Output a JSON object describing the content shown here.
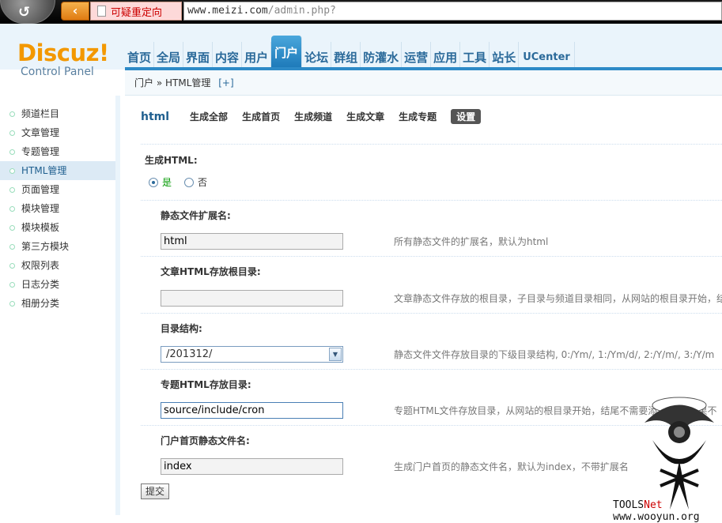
{
  "browser": {
    "warning_text": "可疑重定向",
    "url_base": "www.meizi.com",
    "url_path": "/admin.php?"
  },
  "header": {
    "logo": "Discuz!",
    "logo_sub": "Control Panel",
    "nav": [
      {
        "label": "首页"
      },
      {
        "label": "全局"
      },
      {
        "label": "界面"
      },
      {
        "label": "内容"
      },
      {
        "label": "用户"
      },
      {
        "label": "门户",
        "active": true
      },
      {
        "label": "论坛"
      },
      {
        "label": "群组"
      },
      {
        "label": "防灌水"
      },
      {
        "label": "运营"
      },
      {
        "label": "应用"
      },
      {
        "label": "工具"
      },
      {
        "label": "站长"
      },
      {
        "label": "UCenter"
      }
    ],
    "breadcrumb": {
      "root": "门户",
      "sep": "»",
      "current": "HTML管理",
      "plus": "[+]"
    }
  },
  "sidebar": {
    "items": [
      {
        "label": "频道栏目"
      },
      {
        "label": "文章管理"
      },
      {
        "label": "专题管理"
      },
      {
        "label": "HTML管理",
        "active": true
      },
      {
        "label": "页面管理"
      },
      {
        "label": "模块管理"
      },
      {
        "label": "模块模板"
      },
      {
        "label": "第三方模块"
      },
      {
        "label": "权限列表"
      },
      {
        "label": "日志分类"
      },
      {
        "label": "相册分类"
      }
    ]
  },
  "tabs": {
    "title": "html",
    "items": [
      "生成全部",
      "生成首页",
      "生成频道",
      "生成文章",
      "生成专题"
    ],
    "active": "设置"
  },
  "form": {
    "gen_label": "生成HTML:",
    "yes": "是",
    "no": "否",
    "ext_label": "静态文件扩展名:",
    "ext_value": "html",
    "ext_hint": "所有静态文件的扩展名，默认为html",
    "article_dir_label": "文章HTML存放根目录:",
    "article_dir_value": "",
    "article_dir_hint": "文章静态文件存放的根目录，子目录与频道目录相同，从网站的根目录开始，结",
    "structure_label": "目录结构:",
    "structure_value": "/201312/",
    "structure_hint": "静态文件文件存放目录的下级目录结构, 0:/Ym/, 1:/Ym/d/, 2:/Y/m/, 3:/Y/m",
    "topic_dir_label": "专题HTML存放目录:",
    "topic_dir_value": "source/include/cron",
    "topic_dir_hint": "专题HTML文件存放目录，从网站的根目录开始，结尾不需要添加\"/\"，如果不",
    "index_label": "门户首页静态文件名:",
    "index_value": "index",
    "index_hint": "生成门户首页的静态文件名，默认为index，不带扩展名",
    "submit": "提交"
  },
  "watermark": {
    "text": "TOOLS",
    "accent": "Net",
    "site": "www.wooyun.org"
  }
}
